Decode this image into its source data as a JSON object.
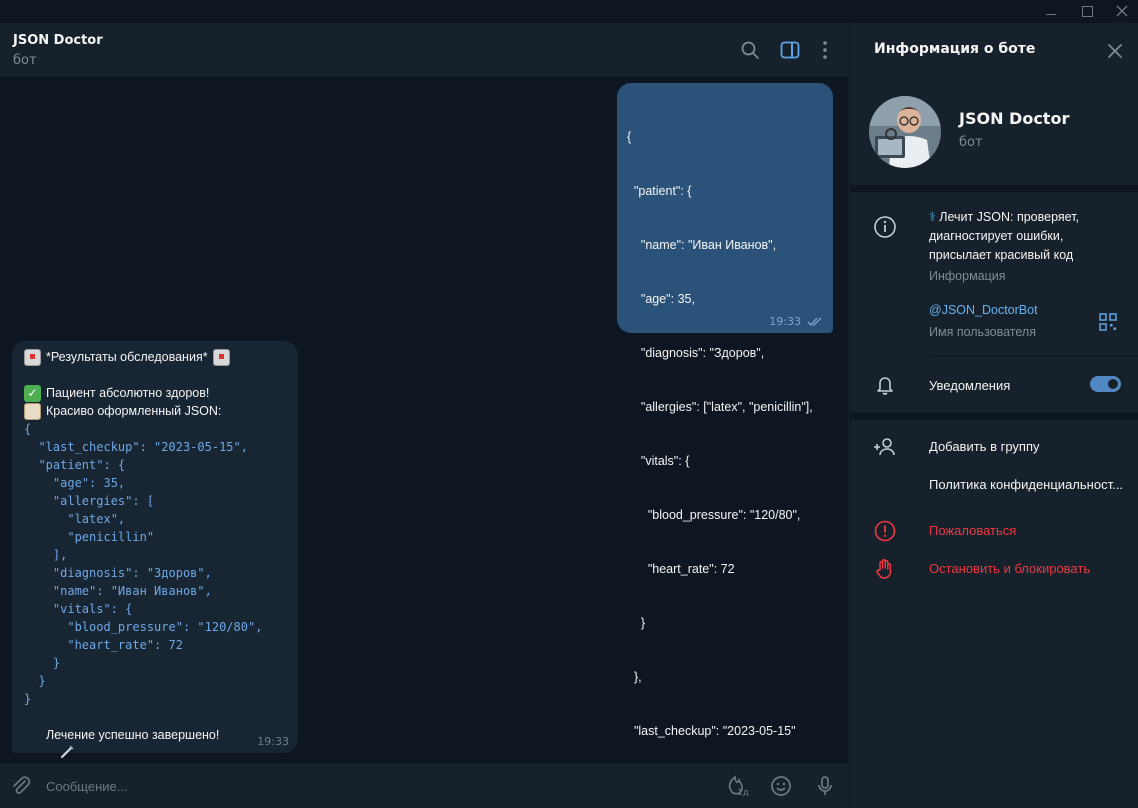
{
  "chat": {
    "title": "JSON Doctor",
    "subtitle": "бот",
    "outgoing": {
      "lines": [
        "{",
        "  \"patient\": {",
        "    \"name\": \"Иван Иванов\",",
        "    \"age\": 35,",
        "    \"diagnosis\": \"Здоров\",",
        "    \"allergies\": [\"latex\", \"penicillin\"],",
        "    \"vitals\": {",
        "      \"blood_pressure\": \"120/80\",",
        "      \"heart_rate\": 72",
        "    }",
        "  },",
        "  \"last_checkup\": \"2023-05-15\"",
        "}"
      ],
      "time": "19:33"
    },
    "incoming": {
      "header": "*Результаты обследования*",
      "healthy": "Пациент абсолютно здоров!",
      "formatted": "Красиво оформленный JSON:",
      "code": "{\n  \"last_checkup\": \"2023-05-15\",\n  \"patient\": {\n    \"age\": 35,\n    \"allergies\": [\n      \"latex\",\n      \"penicillin\"\n    ],\n    \"diagnosis\": \"Здоров\",\n    \"name\": \"Иван Иванов\",\n    \"vitals\": {\n      \"blood_pressure\": \"120/80\",\n      \"heart_rate\": 72\n    }\n  }\n}",
      "footer": "Лечение успешно завершено!",
      "time": "19:33"
    },
    "composer_placeholder": "Сообщение...",
    "scheduled_badge": "1д"
  },
  "panel": {
    "title": "Информация о боте",
    "bot_name": "JSON Doctor",
    "bot_sub": "бот",
    "description": "Лечит JSON: проверяет, диагностирует ошибки, присылает красивый код",
    "description_caption": "Информация",
    "username": "@JSON_DoctorBot",
    "username_caption": "Имя пользователя",
    "notifications": "Уведомления",
    "notifications_on": true,
    "add_to_group": "Добавить в группу",
    "privacy": "Политика конфиденциальност...",
    "report": "Пожаловаться",
    "block": "Остановить и блокировать"
  },
  "colors": {
    "accent": "#5288c1",
    "link": "#64b3f0",
    "danger": "#ec3942",
    "bubble_out": "#2b5278",
    "bubble_in": "#182533",
    "background": "#0e1621"
  }
}
